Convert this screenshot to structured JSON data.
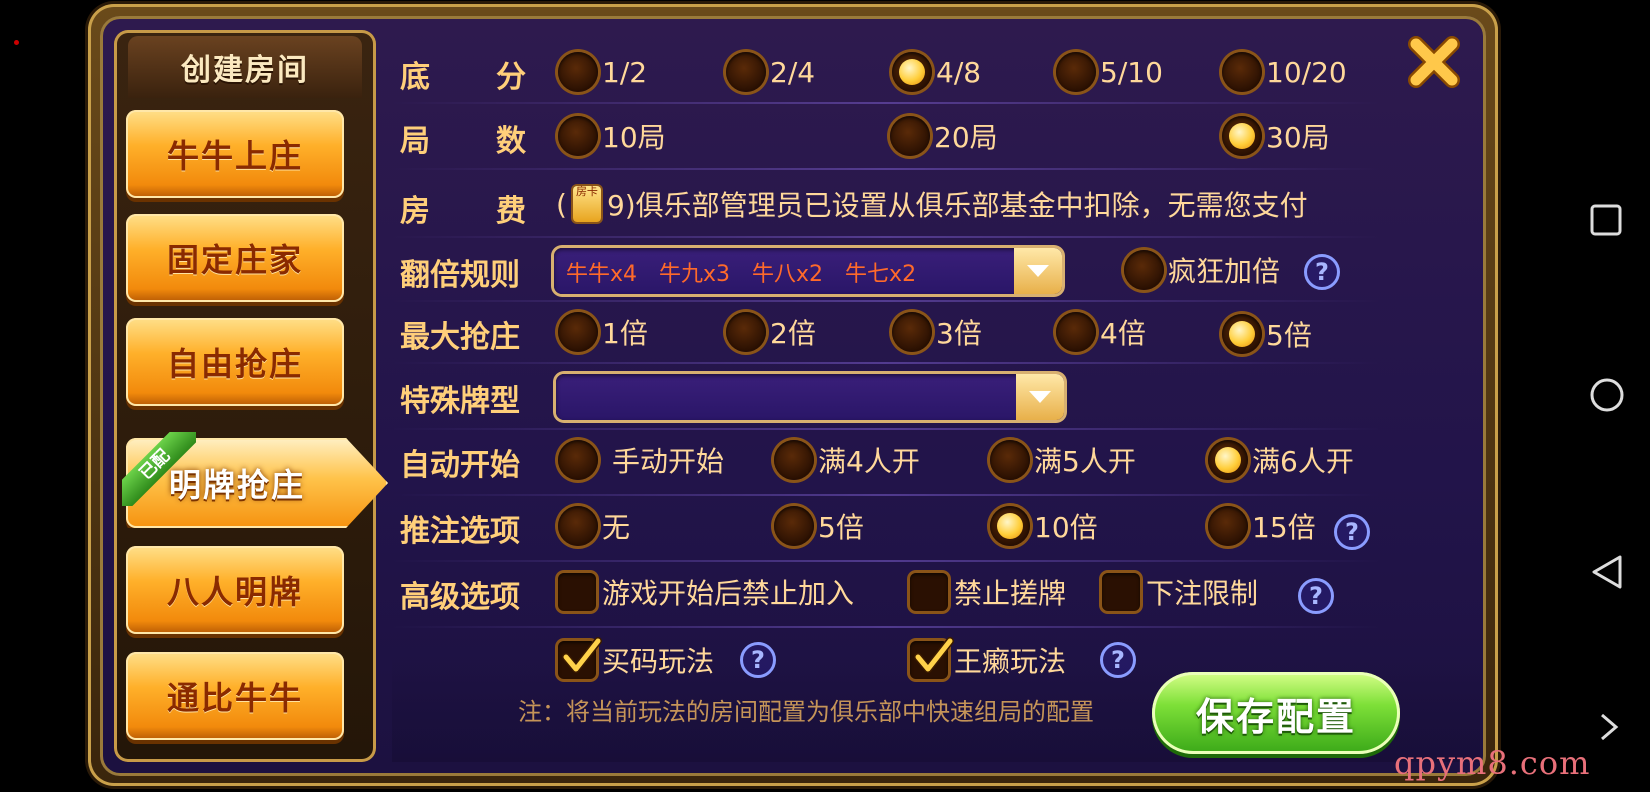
{
  "sidebar": {
    "title": "创建房间",
    "items": [
      {
        "label": "牛牛上庄"
      },
      {
        "label": "固定庄家"
      },
      {
        "label": "自由抢庄"
      },
      {
        "label": "明牌抢庄",
        "active": true,
        "badge": "已配"
      },
      {
        "label": "八人明牌"
      },
      {
        "label": "通比牛牛"
      }
    ]
  },
  "settings": {
    "base_score": {
      "label": "底　　分",
      "options": [
        "1/2",
        "2/4",
        "4/8",
        "5/10",
        "10/20"
      ],
      "selected": "4/8"
    },
    "rounds": {
      "label": "局　　数",
      "options": [
        "10局",
        "20局",
        "30局"
      ],
      "selected": "30局"
    },
    "room_fee": {
      "label": "房　　费",
      "prefix": "(",
      "icon_text": "房卡",
      "text": "9)俱乐部管理员已设置从俱乐部基金中扣除，无需您支付"
    },
    "double_rule": {
      "label": "翻倍规则",
      "value": "牛牛x4　牛九x3　牛八x2　牛七x2",
      "crazy_label": "疯狂加倍",
      "crazy_selected": false
    },
    "max_banker": {
      "label": "最大抢庄",
      "options": [
        "1倍",
        "2倍",
        "3倍",
        "4倍",
        "5倍"
      ],
      "selected": "5倍"
    },
    "special_cards": {
      "label": "特殊牌型",
      "value": ""
    },
    "auto_start": {
      "label": "自动开始",
      "options": [
        "手动开始",
        "满4人开",
        "满5人开",
        "满6人开"
      ],
      "selected": "满6人开"
    },
    "push_bet": {
      "label": "推注选项",
      "options": [
        "无",
        "5倍",
        "10倍",
        "15倍"
      ],
      "selected": "10倍"
    },
    "advanced": {
      "label": "高级选项",
      "options": [
        {
          "label": "游戏开始后禁止加入",
          "checked": false
        },
        {
          "label": "禁止搓牌",
          "checked": false
        },
        {
          "label": "下注限制",
          "checked": false
        }
      ]
    },
    "extra": [
      {
        "label": "买码玩法",
        "checked": true
      },
      {
        "label": "王癞玩法",
        "checked": true
      }
    ]
  },
  "footer": {
    "note": "注：将当前玩法的房间配置为俱乐部中快速组局的配置",
    "save_label": "保存配置"
  },
  "watermark": "qpym8.com",
  "colors": {
    "accent_gold": "#ffcf7a",
    "panel_purple": "#2e1a4e",
    "save_green": "#7ee038",
    "dropdown_text": "#ff6a2a"
  }
}
